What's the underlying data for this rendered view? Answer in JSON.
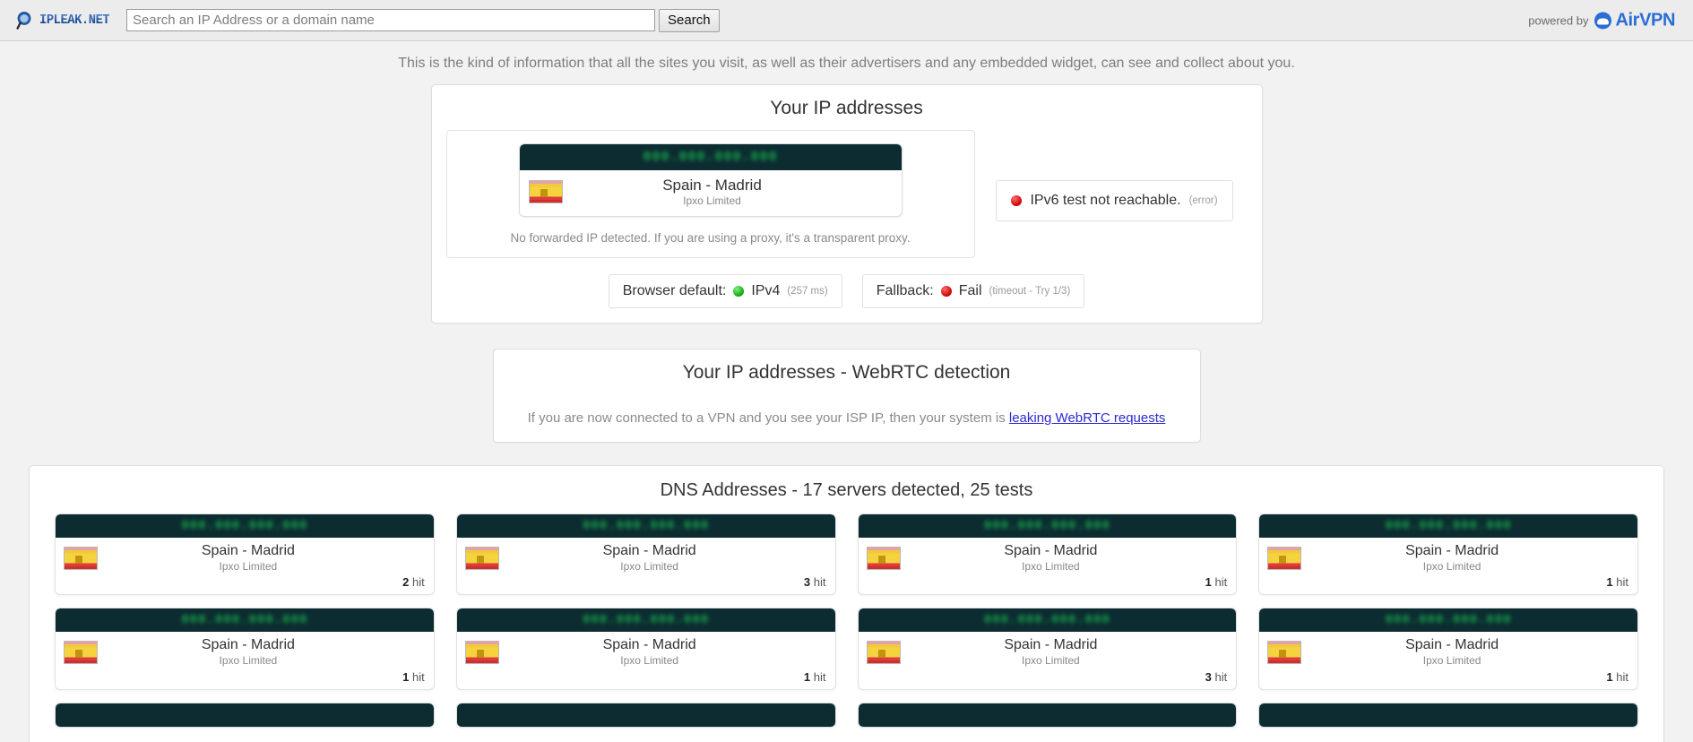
{
  "header": {
    "logo_text": "IPLEAK.NET",
    "search_placeholder": "Search an IP Address or a domain name",
    "search_value": "",
    "search_button": "Search",
    "powered_by_label": "powered by",
    "powered_by_brand": "AirVPN"
  },
  "intro": {
    "text": "This is the kind of information that all the sites you visit, as well as their advertisers and any embedded widget, can see and collect about you."
  },
  "ip_panel": {
    "title": "Your IP addresses",
    "primary": {
      "ip_masked": "000.000.000.000",
      "location": "Spain - Madrid",
      "isp": "Ipxo Limited",
      "flag": "spain-flag"
    },
    "forwarded_note": "No forwarded IP detected. If you are using a proxy, it's a transparent proxy.",
    "ipv6": {
      "status_dot": "red",
      "text": "IPv6 test not reachable.",
      "sub": "(error)"
    },
    "status": [
      {
        "label": "Browser default:",
        "dot": "green",
        "value": "IPv4",
        "sub": "(257 ms)"
      },
      {
        "label": "Fallback:",
        "dot": "red",
        "value": "Fail",
        "sub": "(timeout - Try 1/3)"
      }
    ]
  },
  "webrtc_panel": {
    "title": "Your IP addresses - WebRTC detection",
    "note_prefix": "If you are now connected to a VPN and you see your ISP IP, then your system is ",
    "note_link": "leaking WebRTC requests"
  },
  "dns_panel": {
    "title": "DNS Addresses - 17 servers detected, 25 tests",
    "servers_detected": 17,
    "tests": 25,
    "cards": [
      {
        "ip_masked": "000.000.000.000",
        "location": "Spain - Madrid",
        "isp": "Ipxo Limited",
        "hit_count": "2",
        "hit_label": "hit"
      },
      {
        "ip_masked": "000.000.000.000",
        "location": "Spain - Madrid",
        "isp": "Ipxo Limited",
        "hit_count": "3",
        "hit_label": "hit"
      },
      {
        "ip_masked": "000.000.000.000",
        "location": "Spain - Madrid",
        "isp": "Ipxo Limited",
        "hit_count": "1",
        "hit_label": "hit"
      },
      {
        "ip_masked": "000.000.000.000",
        "location": "Spain - Madrid",
        "isp": "Ipxo Limited",
        "hit_count": "1",
        "hit_label": "hit"
      },
      {
        "ip_masked": "000.000.000.000",
        "location": "Spain - Madrid",
        "isp": "Ipxo Limited",
        "hit_count": "1",
        "hit_label": "hit"
      },
      {
        "ip_masked": "000.000.000.000",
        "location": "Spain - Madrid",
        "isp": "Ipxo Limited",
        "hit_count": "1",
        "hit_label": "hit"
      },
      {
        "ip_masked": "000.000.000.000",
        "location": "Spain - Madrid",
        "isp": "Ipxo Limited",
        "hit_count": "3",
        "hit_label": "hit"
      },
      {
        "ip_masked": "000.000.000.000",
        "location": "Spain - Madrid",
        "isp": "Ipxo Limited",
        "hit_count": "1",
        "hit_label": "hit"
      }
    ]
  },
  "colors": {
    "page_bg": "#f2f2f2",
    "topbar_bg": "#ececec",
    "ip_screen_bg": "#0c2c31",
    "ip_screen_fg": "#18a84a",
    "brand_blue": "#2a6ed4",
    "link_blue": "#2a2ad0",
    "status_green": "#0ea60e",
    "status_red": "#cc0000"
  }
}
